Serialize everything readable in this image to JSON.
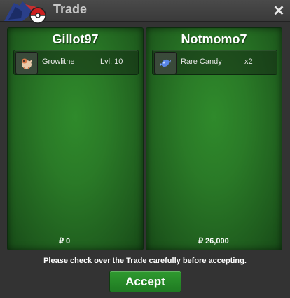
{
  "window": {
    "title": "Trade",
    "close_label": "✕"
  },
  "left_panel": {
    "player": "Gillot97",
    "item": {
      "name": "Growlithe",
      "detail": "Lvl: 10",
      "icon": "growlithe-icon"
    },
    "money": "₽ 0"
  },
  "right_panel": {
    "player": "Notmomo7",
    "item": {
      "name": "Rare Candy",
      "detail": "x2",
      "icon": "rare-candy-icon"
    },
    "money": "₽ 26,000"
  },
  "notice": "Please check over the Trade carefully before accepting.",
  "accept_label": "Accept",
  "colors": {
    "panel_green": "#2a7a27",
    "button_green": "#27882a",
    "title_bg": "#444444"
  }
}
